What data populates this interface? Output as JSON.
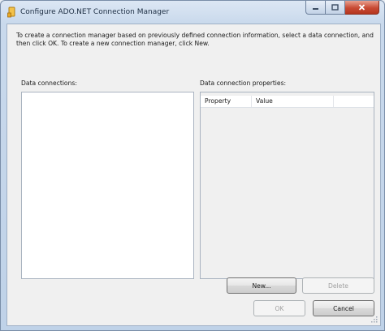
{
  "window": {
    "title": "Configure ADO.NET Connection Manager",
    "icon": "ssis-package-icon"
  },
  "caption_buttons": {
    "minimize_icon": "minimize-icon",
    "maximize_icon": "maximize-icon",
    "close_icon": "close-icon"
  },
  "instructions": "To create a connection manager based on previously defined connection information, select a data connection, and then click OK. To create a new connection manager, click New.",
  "data_connections": {
    "label": "Data connections:",
    "items": []
  },
  "properties": {
    "label": "Data connection properties:",
    "columns": [
      "Property",
      "Value"
    ],
    "rows": []
  },
  "buttons": {
    "new": "New...",
    "delete": "Delete",
    "ok": "OK",
    "cancel": "Cancel"
  },
  "colors": {
    "title_bar": "#c9d9ec",
    "client_background": "#f0f0f0",
    "close_button": "#c84a33"
  }
}
